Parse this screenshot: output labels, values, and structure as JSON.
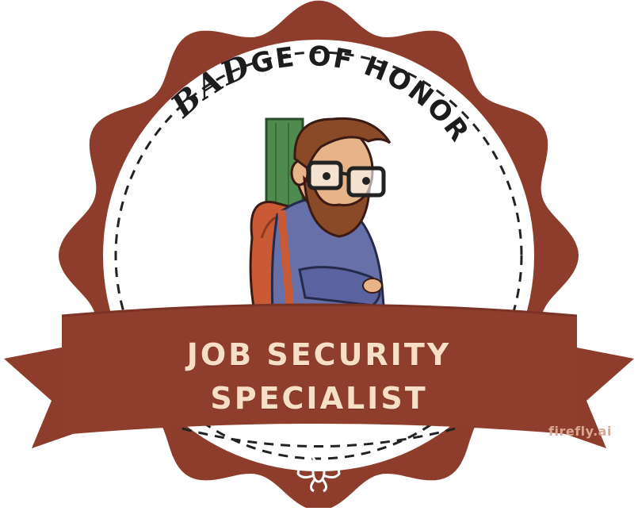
{
  "badge": {
    "arc_prefix": "BAD",
    "arc_rest": "GE OF HONOR",
    "line1": "JOB SECURITY",
    "line2": "SPECIALIST",
    "watermark": "firefly.ai",
    "logo_icon": "bee-icon",
    "illustration": "bearded-man-with-glasses-and-backpack"
  },
  "colors": {
    "seal": "#8e3d2c",
    "banner": "#8f3e2d",
    "banner_dark": "#5c2117",
    "text_light": "#f6dfc6",
    "inner": "#ffffff",
    "door": "#4f8a4f"
  }
}
